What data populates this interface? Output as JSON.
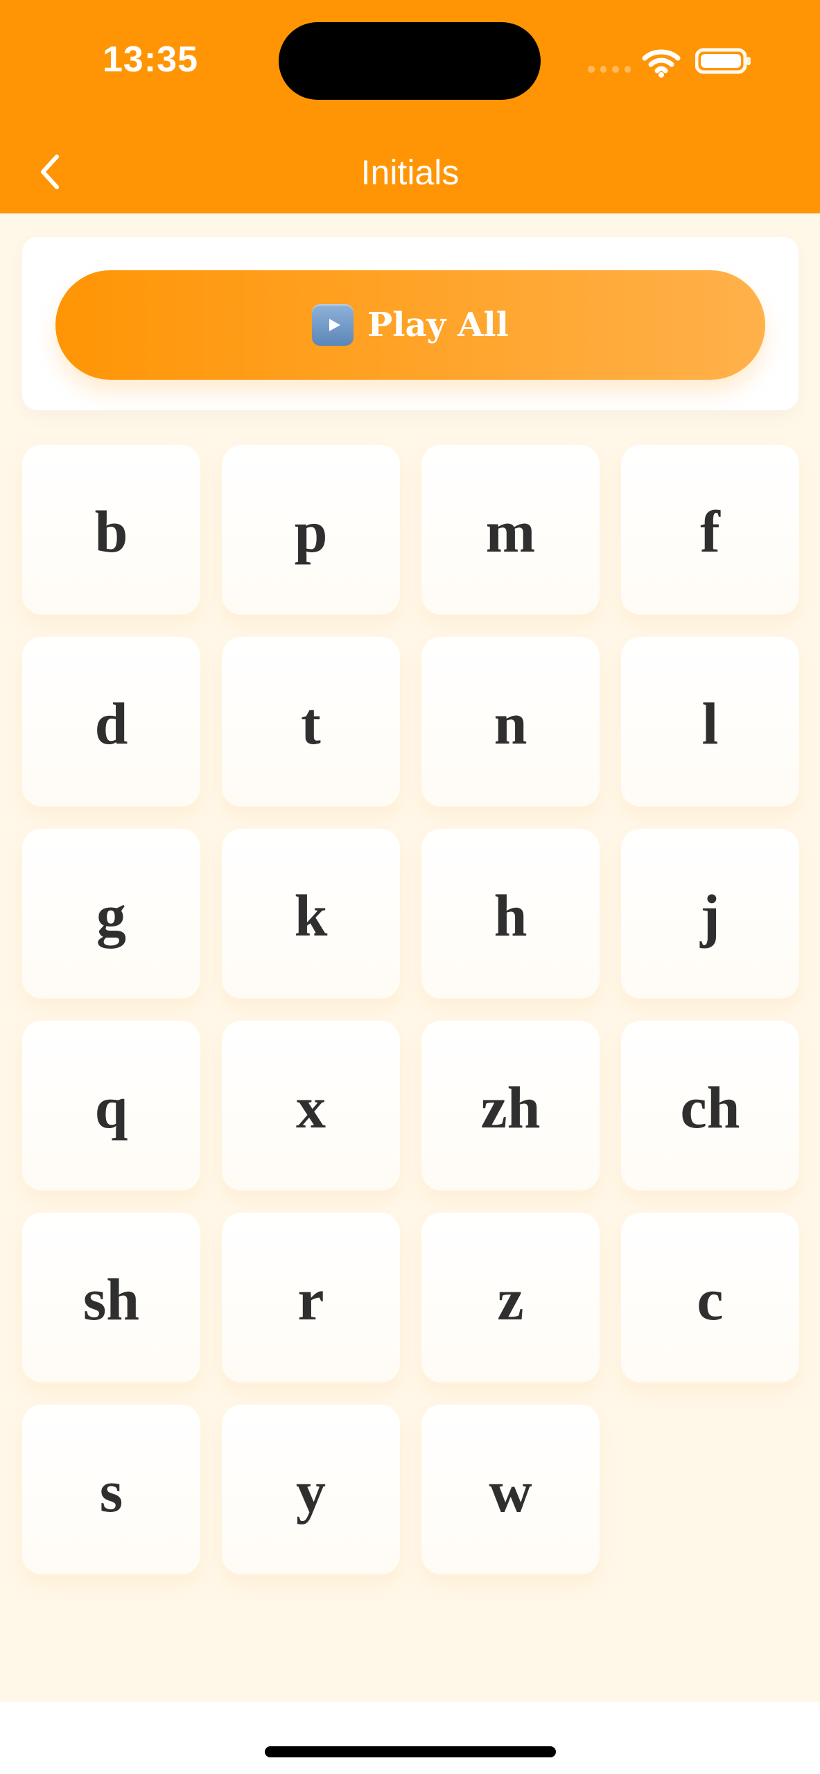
{
  "status": {
    "time": "13:35"
  },
  "header": {
    "title": "Initials"
  },
  "actions": {
    "play_all_label": "Play All"
  },
  "initials": [
    "b",
    "p",
    "m",
    "f",
    "d",
    "t",
    "n",
    "l",
    "g",
    "k",
    "h",
    "j",
    "q",
    "x",
    "zh",
    "ch",
    "sh",
    "r",
    "z",
    "c",
    "s",
    "y",
    "w"
  ],
  "colors": {
    "primary_orange": "#FF9505",
    "background_cream": "#FFF7E8",
    "tile_white": "#FFFCF6"
  },
  "icons": {
    "back": "chevron-left-icon",
    "wifi": "wifi-icon",
    "battery": "battery-icon",
    "play": "play-icon"
  }
}
